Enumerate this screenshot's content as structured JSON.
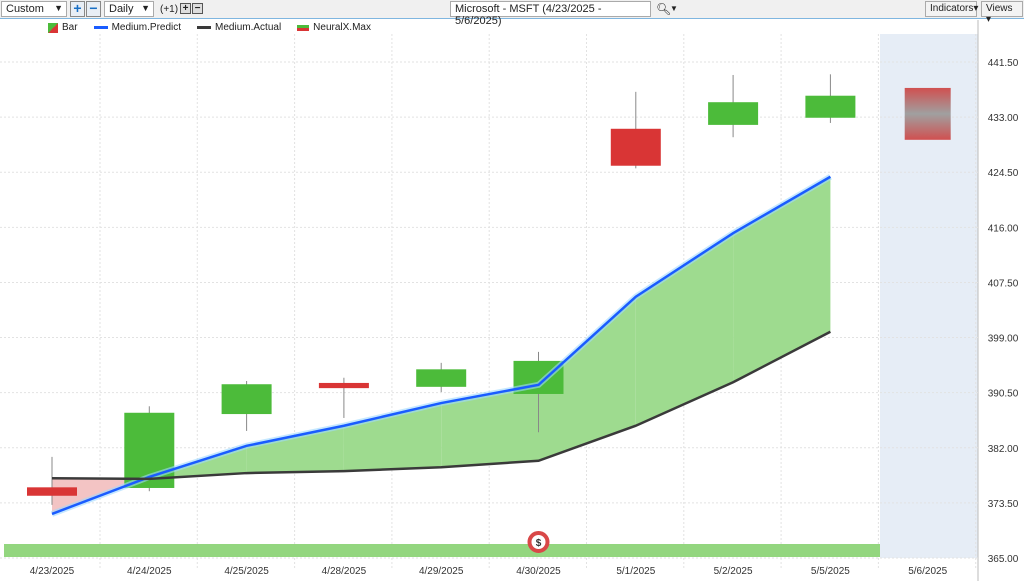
{
  "toolbar": {
    "period": "Custom",
    "interval": "Daily",
    "offset": "(+1)",
    "symbol": "Microsoft - MSFT (4/23/2025 - 5/6/2025)",
    "indicators": "Indicators",
    "views": "Views"
  },
  "legend": [
    {
      "label": "Bar"
    },
    {
      "label": "Medium.Predict"
    },
    {
      "label": "Medium.Actual"
    },
    {
      "label": "NeuralX.Max"
    }
  ],
  "colors": {
    "up": "#4cbb3a",
    "down": "#d93535",
    "predict": "#1a5cff",
    "actual": "#3a3a3a",
    "fill_pos": "#9edb8f",
    "fill_neg": "#f3c4c4",
    "forecast_bg": "#e6edf6"
  },
  "chart_data": {
    "type": "candlestick",
    "categories": [
      "4/23/2025",
      "4/24/2025",
      "4/25/2025",
      "4/28/2025",
      "4/29/2025",
      "4/30/2025",
      "5/1/2025",
      "5/2/2025",
      "5/5/2025",
      "5/6/2025"
    ],
    "y_ticks": [
      "441.50",
      "433.00",
      "424.50",
      "416.00",
      "407.50",
      "399.00",
      "390.50",
      "382.00",
      "373.50",
      "365.00"
    ],
    "ylim": [
      365,
      441.5
    ],
    "ohlc": [
      [
        375.9,
        380.6,
        373.2,
        374.6
      ],
      [
        375.8,
        388.4,
        375.3,
        387.4
      ],
      [
        387.2,
        392.3,
        384.6,
        391.8
      ],
      [
        392.0,
        392.8,
        386.6,
        391.2
      ],
      [
        391.4,
        395.1,
        390.6,
        394.1
      ],
      [
        390.3,
        396.8,
        384.4,
        395.4
      ],
      [
        431.2,
        436.9,
        425.1,
        425.5
      ],
      [
        431.8,
        439.5,
        429.9,
        435.3
      ],
      [
        432.9,
        439.6,
        432.1,
        436.3
      ]
    ],
    "neuralx_max": {
      "date": "5/6/2025",
      "high": 437.5,
      "low": 429.5
    },
    "medium_predict": [
      371.8,
      377.5,
      382.3,
      385.4,
      388.9,
      391.7,
      405.3,
      415.1,
      423.8
    ],
    "medium_actual": [
      377.3,
      377.2,
      378.1,
      378.4,
      379.0,
      380.0,
      385.4,
      392.1,
      399.9
    ]
  },
  "event_marker": {
    "symbol": "$",
    "date": "4/30/2025"
  }
}
